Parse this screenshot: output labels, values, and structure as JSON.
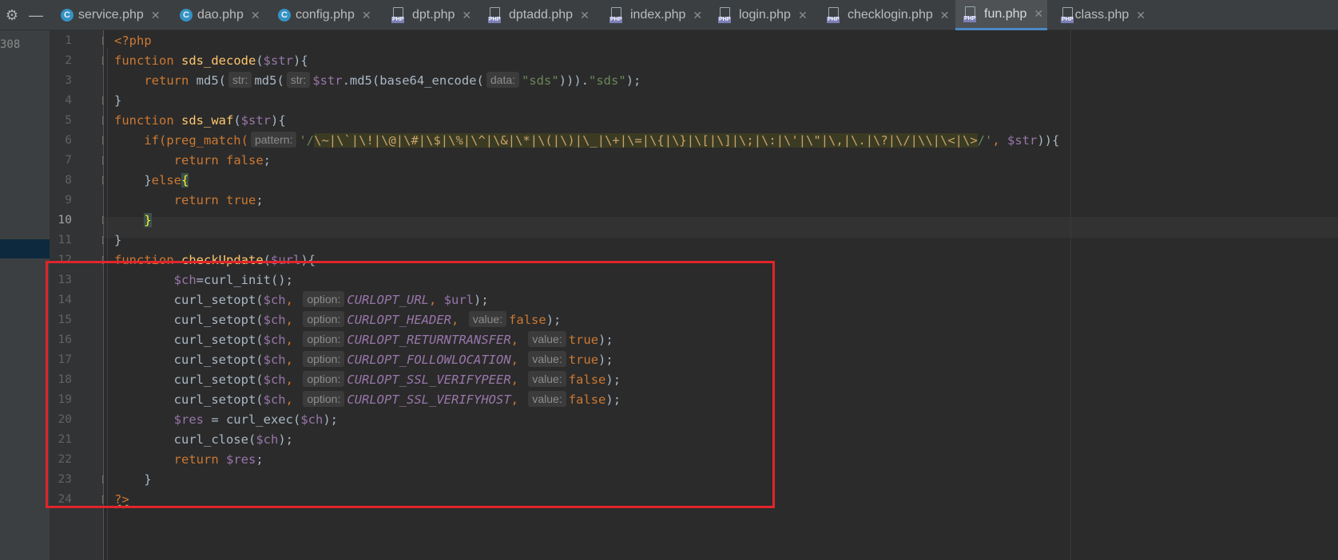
{
  "toolbar": {
    "settings_icon": "gear-icon",
    "minimize_icon": "minus-icon"
  },
  "left_panel": {
    "number": "308"
  },
  "tabs": [
    {
      "label": "service.php",
      "icon": "c",
      "active": false
    },
    {
      "label": "dao.php",
      "icon": "c",
      "active": false
    },
    {
      "label": "config.php",
      "icon": "c",
      "active": false
    },
    {
      "label": "dpt.php",
      "icon": "php",
      "active": false
    },
    {
      "label": "dptadd.php",
      "icon": "php",
      "active": false
    },
    {
      "label": "index.php",
      "icon": "php",
      "active": false
    },
    {
      "label": "login.php",
      "icon": "php",
      "active": false
    },
    {
      "label": "checklogin.php",
      "icon": "php",
      "active": false
    },
    {
      "label": "fun.php",
      "icon": "php",
      "active": true
    },
    {
      "label": "class.php",
      "icon": "php",
      "active": false
    }
  ],
  "tab_icon_labels": {
    "c": "C",
    "php": "PHP"
  },
  "tab_close_glyph": "✕",
  "line_numbers": [
    "1",
    "2",
    "3",
    "4",
    "5",
    "6",
    "7",
    "8",
    "9",
    "10",
    "11",
    "12",
    "13",
    "14",
    "15",
    "16",
    "17",
    "18",
    "19",
    "20",
    "21",
    "22",
    "23",
    "24"
  ],
  "current_line": 10,
  "code": {
    "l1": {
      "open": "<?php"
    },
    "l2": {
      "kw": "function",
      "name": "sds_decode",
      "p1": "(",
      "arg": "$str",
      "p2": "){"
    },
    "l3": {
      "indent": "    ",
      "kw": "return",
      "t1": " md5(",
      "h1": "str:",
      "t2": "md5(",
      "h2": "str:",
      "v1": "$str",
      "t3": ".md5(base64_encode(",
      "h3": "data:",
      "s1": "\"sds\"",
      "t4": "))).",
      "s2": "\"sds\"",
      "t5": ");"
    },
    "l4": {
      "t": "}"
    },
    "l5": {
      "kw": "function",
      "name": "sds_waf",
      "p1": "(",
      "arg": "$str",
      "p2": "){"
    },
    "l6": {
      "indent": "    ",
      "t1": "if(preg_match(",
      "h1": "pattern:",
      "s1": "'/",
      "rx": "\\~|\\`|\\!|\\@|\\#|\\$|\\%|\\^|\\&|\\*|\\(|\\)|\\_|\\+|\\=|\\{|\\}|\\[|\\]|\\;|\\:|\\'|\\\"|\\,|\\.|\\?|\\/|\\\\|\\<|\\>",
      "s2": "/'",
      "t2": ", ",
      "v1": "$str",
      "t3": ")){"
    },
    "l7": {
      "indent": "        ",
      "kw": "return",
      "val": " false",
      "t": ";"
    },
    "l8": {
      "indent": "    ",
      "t1": "}",
      "kw": "else",
      "brace": "{"
    },
    "l9": {
      "indent": "        ",
      "kw": "return",
      "val": " true",
      "t": ";"
    },
    "l10": {
      "indent": "    ",
      "brace": "}"
    },
    "l11": {
      "t": "}"
    },
    "l12": {
      "kw": "function",
      "name": "checkUpdate",
      "p1": "(",
      "arg": "$url",
      "p2": "){"
    },
    "l13": {
      "indent": "        ",
      "v1": "$ch",
      "t1": "=curl_init();"
    },
    "l14": {
      "indent": "        ",
      "t1": "curl_setopt(",
      "v1": "$ch",
      "t2": ", ",
      "h1": "option:",
      "c1": "CURLOPT_URL",
      "t3": ", ",
      "v2": "$url",
      "t4": ");"
    },
    "l15": {
      "indent": "        ",
      "t1": "curl_setopt(",
      "v1": "$ch",
      "t2": ", ",
      "h1": "option:",
      "c1": "CURLOPT_HEADER",
      "t3": ", ",
      "h2": "value:",
      "val": "false",
      "t4": ");"
    },
    "l16": {
      "indent": "        ",
      "t1": "curl_setopt(",
      "v1": "$ch",
      "t2": ", ",
      "h1": "option:",
      "c1": "CURLOPT_RETURNTRANSFER",
      "t3": ", ",
      "h2": "value:",
      "val": "true",
      "t4": ");"
    },
    "l17": {
      "indent": "        ",
      "t1": "curl_setopt(",
      "v1": "$ch",
      "t2": ", ",
      "h1": "option:",
      "c1": "CURLOPT_FOLLOWLOCATION",
      "t3": ", ",
      "h2": "value:",
      "val": "true",
      "t4": ");"
    },
    "l18": {
      "indent": "        ",
      "t1": "curl_setopt(",
      "v1": "$ch",
      "t2": ", ",
      "h1": "option:",
      "c1": "CURLOPT_SSL_VERIFYPEER",
      "t3": ", ",
      "h2": "value:",
      "val": "false",
      "t4": ");"
    },
    "l19": {
      "indent": "        ",
      "t1": "curl_setopt(",
      "v1": "$ch",
      "t2": ", ",
      "h1": "option:",
      "c1": "CURLOPT_SSL_VERIFYHOST",
      "t3": ", ",
      "h2": "value:",
      "val": "false",
      "t4": ");"
    },
    "l20": {
      "indent": "        ",
      "v1": "$res",
      "t1": " = curl_exec(",
      "v2": "$ch",
      "t2": ");"
    },
    "l21": {
      "indent": "        ",
      "t1": "curl_close(",
      "v1": "$ch",
      "t2": ");"
    },
    "l22": {
      "indent": "        ",
      "kw": "return",
      "t1": " ",
      "v1": "$res",
      "t2": ";"
    },
    "l23": {
      "indent": "    ",
      "t": "}"
    },
    "l24": {
      "close": "?>"
    }
  },
  "colors": {
    "keyword": "#cc7832",
    "function": "#ffc66d",
    "variable": "#9876aa",
    "string": "#6a8759",
    "annotation_box": "#e0252b"
  }
}
